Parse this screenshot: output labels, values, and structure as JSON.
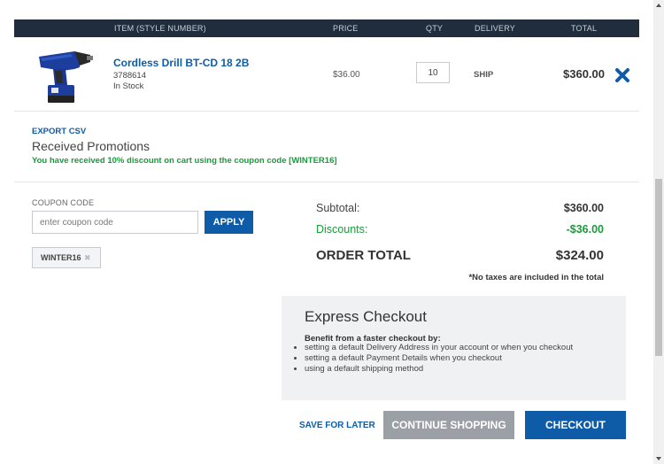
{
  "table_header": {
    "item": "ITEM (STYLE NUMBER)",
    "price": "PRICE",
    "qty": "QTY",
    "delivery": "DELIVERY",
    "total": "TOTAL"
  },
  "cart_item": {
    "name": "Cordless Drill BT-CD 18 2B",
    "sku": "3788614",
    "stock": "In Stock",
    "price": "$36.00",
    "qty": "10",
    "delivery": "SHIP",
    "total": "$360.00",
    "image_icon": "cordless-drill-image",
    "remove_icon": "close-icon"
  },
  "promotions": {
    "export_label": "EXPORT CSV",
    "heading": "Received Promotions",
    "message": "You have received 10% discount on cart using the coupon code [WINTER16]"
  },
  "coupon": {
    "label": "COUPON CODE",
    "placeholder": "enter coupon code",
    "apply_label": "APPLY",
    "applied_code": "WINTER16",
    "chip_remove": "✖"
  },
  "summary": {
    "subtotal_label": "Subtotal:",
    "subtotal_value": "$360.00",
    "discounts_label": "Discounts:",
    "discounts_value": "-$36.00",
    "order_total_label": "ORDER TOTAL",
    "order_total_value": "$324.00",
    "tax_note": "*No taxes are included in the total"
  },
  "express_checkout": {
    "title": "Express Checkout",
    "subtitle": "Benefit from a faster checkout by:",
    "items": [
      "setting a default Delivery Address in your account or when you checkout",
      "setting a default Payment Details when you checkout",
      "using a default shipping method"
    ]
  },
  "actions": {
    "save_for_later": "SAVE FOR LATER",
    "continue_shopping": "CONTINUE SHOPPING",
    "checkout": "CHECKOUT"
  },
  "colors": {
    "header_bg": "#1f2d3d",
    "link_blue": "#0e5ca8",
    "success_green": "#1a9a3b",
    "continue_gray": "#9aa0a6",
    "express_bg": "#f0f1f3"
  }
}
